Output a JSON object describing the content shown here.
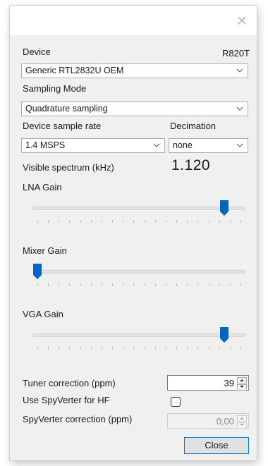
{
  "device": {
    "label": "Device",
    "tuner_name": "R820T",
    "selected": "Generic RTL2832U OEM"
  },
  "sampling_mode": {
    "label": "Sampling Mode",
    "selected": "Quadrature sampling"
  },
  "sample_rate": {
    "label": "Device sample rate",
    "selected": "1.4 MSPS"
  },
  "decimation": {
    "label": "Decimation",
    "selected": "none"
  },
  "visible_spectrum": {
    "label": "Visible spectrum (kHz)",
    "value": "1.120"
  },
  "lna_gain": {
    "label": "LNA Gain",
    "level": 0.92
  },
  "mixer_gain": {
    "label": "Mixer Gain",
    "level": 0.0
  },
  "vga_gain": {
    "label": "VGA Gain",
    "level": 0.92
  },
  "tuner_correction": {
    "label": "Tuner correction (ppm)",
    "value": "39"
  },
  "spyverter": {
    "label": "Use SpyVerter for HF",
    "checked": false
  },
  "spyverter_correction": {
    "label": "SpyVerter correction (ppm)",
    "value": "0,00"
  },
  "buttons": {
    "close": "Close"
  },
  "icons": {
    "title_close": "close-icon",
    "dropdown": "chevron-down-icon",
    "slider_thumb": "slider-thumb",
    "spinner": "spinner-arrows-icon"
  },
  "colors": {
    "accent": "#0067c0",
    "button_border": "#0078d7",
    "dialog_bg": "#f0f0f0"
  }
}
